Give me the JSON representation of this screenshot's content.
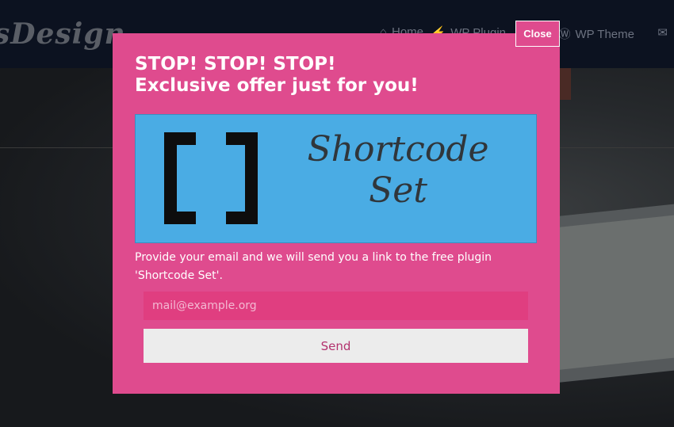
{
  "site": {
    "logo_text": "sDesign",
    "nav": [
      {
        "label": "Home",
        "icon": "home-icon",
        "glyph": "⌂"
      },
      {
        "label": "WP Plugin",
        "icon": "plug-icon",
        "glyph": "⚡"
      },
      {
        "label": "WP Theme",
        "icon": "wordpress-icon",
        "glyph": "Ⓦ"
      },
      {
        "label": "",
        "icon": "mail-icon",
        "glyph": "✉"
      }
    ]
  },
  "modal": {
    "close_label": "Close",
    "title_line1": "STOP! STOP! STOP!",
    "title_line2": "Exclusive offer just for you!",
    "banner": {
      "line1": "Shortcode",
      "line2": "Set"
    },
    "description": "Provide your email and we will send you a link to the free plugin 'Shortcode Set'.",
    "email_placeholder": "mail@example.org",
    "send_label": "Send"
  },
  "colors": {
    "modal_bg": "#df4b8e",
    "banner_bg": "#4aace4",
    "input_bg": "#e03e80",
    "button_bg": "#ececec",
    "button_text": "#b3326e"
  }
}
